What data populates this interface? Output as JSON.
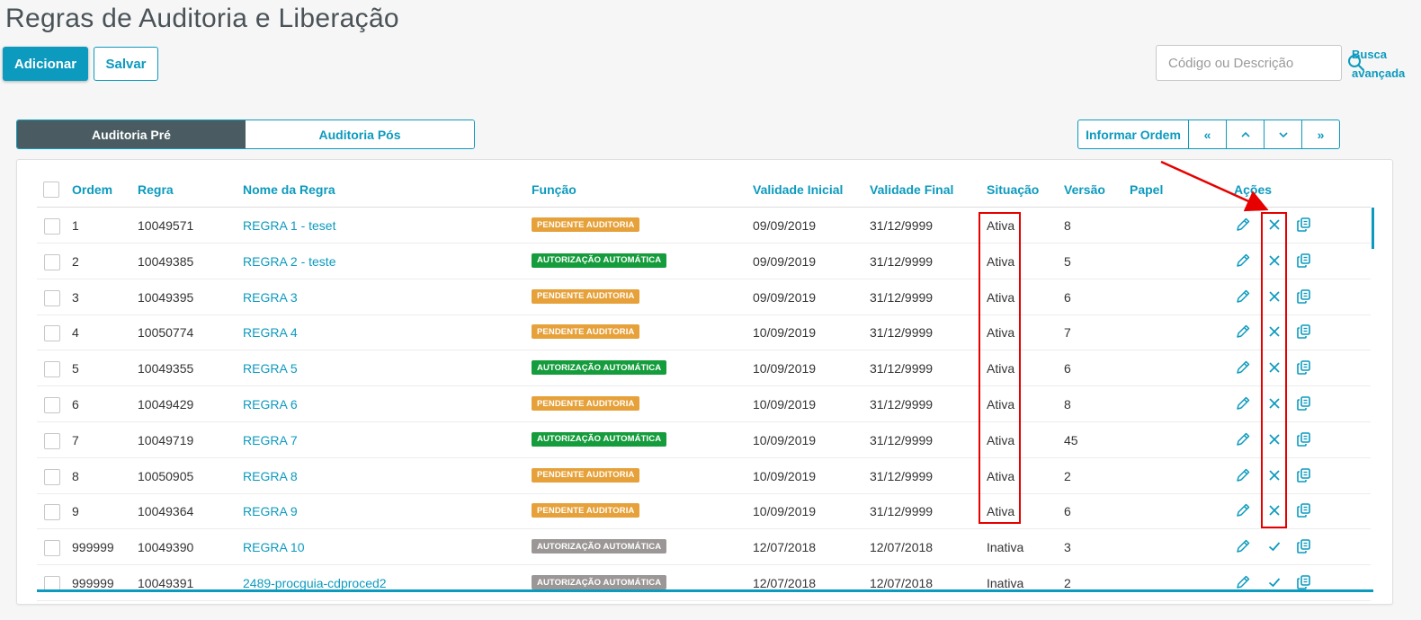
{
  "page": {
    "title": "Regras de Auditoria e Liberação"
  },
  "toolbar": {
    "add_label": "Adicionar",
    "save_label": "Salvar"
  },
  "search": {
    "placeholder": "Código ou Descrição",
    "advanced_label": "Busca avançada"
  },
  "tabs": [
    {
      "label": "Auditoria Pré",
      "active": true
    },
    {
      "label": "Auditoria Pós",
      "active": false
    }
  ],
  "order_controls": {
    "inform_label": "Informar Ordem",
    "first": "«",
    "up": "⌃",
    "down": "⌄",
    "last": "»"
  },
  "table": {
    "columns": [
      "Ordem",
      "Regra",
      "Nome da Regra",
      "Função",
      "Validade Inicial",
      "Validade Final",
      "Situação",
      "Versão",
      "Papel",
      "Ações"
    ],
    "rows": [
      {
        "ordem": "1",
        "regra": "10049571",
        "nome": "REGRA 1 - teset",
        "funcao": "PENDENTE AUDITORIA",
        "funcao_color": "#e6a13a",
        "validade_inicial": "09/09/2019",
        "validade_final": "31/12/9999",
        "situacao": "Ativa",
        "versao": "8",
        "papel": "",
        "action": "deactivate"
      },
      {
        "ordem": "2",
        "regra": "10049385",
        "nome": "REGRA 2 - teste",
        "funcao": "AUTORIZAÇÃO AUTOMÁTICA",
        "funcao_color": "#159c3c",
        "validade_inicial": "09/09/2019",
        "validade_final": "31/12/9999",
        "situacao": "Ativa",
        "versao": "5",
        "papel": "",
        "action": "deactivate"
      },
      {
        "ordem": "3",
        "regra": "10049395",
        "nome": "REGRA 3",
        "funcao": "PENDENTE AUDITORIA",
        "funcao_color": "#e6a13a",
        "validade_inicial": "09/09/2019",
        "validade_final": "31/12/9999",
        "situacao": "Ativa",
        "versao": "6",
        "papel": "",
        "action": "deactivate"
      },
      {
        "ordem": "4",
        "regra": "10050774",
        "nome": "REGRA 4",
        "funcao": "PENDENTE AUDITORIA",
        "funcao_color": "#e6a13a",
        "validade_inicial": "10/09/2019",
        "validade_final": "31/12/9999",
        "situacao": "Ativa",
        "versao": "7",
        "papel": "",
        "action": "deactivate"
      },
      {
        "ordem": "5",
        "regra": "10049355",
        "nome": "REGRA 5",
        "funcao": "AUTORIZAÇÃO AUTOMÁTICA",
        "funcao_color": "#159c3c",
        "validade_inicial": "10/09/2019",
        "validade_final": "31/12/9999",
        "situacao": "Ativa",
        "versao": "6",
        "papel": "",
        "action": "deactivate"
      },
      {
        "ordem": "6",
        "regra": "10049429",
        "nome": "REGRA 6",
        "funcao": "PENDENTE AUDITORIA",
        "funcao_color": "#e6a13a",
        "validade_inicial": "10/09/2019",
        "validade_final": "31/12/9999",
        "situacao": "Ativa",
        "versao": "8",
        "papel": "",
        "action": "deactivate"
      },
      {
        "ordem": "7",
        "regra": "10049719",
        "nome": "REGRA 7",
        "funcao": "AUTORIZAÇÃO AUTOMÁTICA",
        "funcao_color": "#159c3c",
        "validade_inicial": "10/09/2019",
        "validade_final": "31/12/9999",
        "situacao": "Ativa",
        "versao": "45",
        "papel": "",
        "action": "deactivate"
      },
      {
        "ordem": "8",
        "regra": "10050905",
        "nome": "REGRA 8",
        "funcao": "PENDENTE AUDITORIA",
        "funcao_color": "#e6a13a",
        "validade_inicial": "10/09/2019",
        "validade_final": "31/12/9999",
        "situacao": "Ativa",
        "versao": "2",
        "papel": "",
        "action": "deactivate"
      },
      {
        "ordem": "9",
        "regra": "10049364",
        "nome": "REGRA 9",
        "funcao": "PENDENTE AUDITORIA",
        "funcao_color": "#e6a13a",
        "validade_inicial": "10/09/2019",
        "validade_final": "31/12/9999",
        "situacao": "Ativa",
        "versao": "6",
        "papel": "",
        "action": "deactivate"
      },
      {
        "ordem": "999999",
        "regra": "10049390",
        "nome": "REGRA 10",
        "funcao": "AUTORIZAÇÃO AUTOMÁTICA",
        "funcao_color": "#9c9797",
        "validade_inicial": "12/07/2018",
        "validade_final": "12/07/2018",
        "situacao": "Inativa",
        "versao": "3",
        "papel": "",
        "action": "activate"
      },
      {
        "ordem": "999999",
        "regra": "10049391",
        "nome": "2489-procguia-cdproced2",
        "funcao": "AUTORIZAÇÃO AUTOMÁTICA",
        "funcao_color": "#9c9797",
        "validade_inicial": "12/07/2018",
        "validade_final": "12/07/2018",
        "situacao": "Inativa",
        "versao": "2",
        "papel": "",
        "action": "activate"
      }
    ]
  },
  "colors": {
    "accent": "#0c9abe",
    "tab_active": "#4a5c62",
    "annotation": "#e60000"
  },
  "icons": {
    "search": "search-icon",
    "edit": "pencil-icon",
    "deactivate": "close-icon",
    "activate": "check-icon",
    "copy": "copy-icon"
  }
}
